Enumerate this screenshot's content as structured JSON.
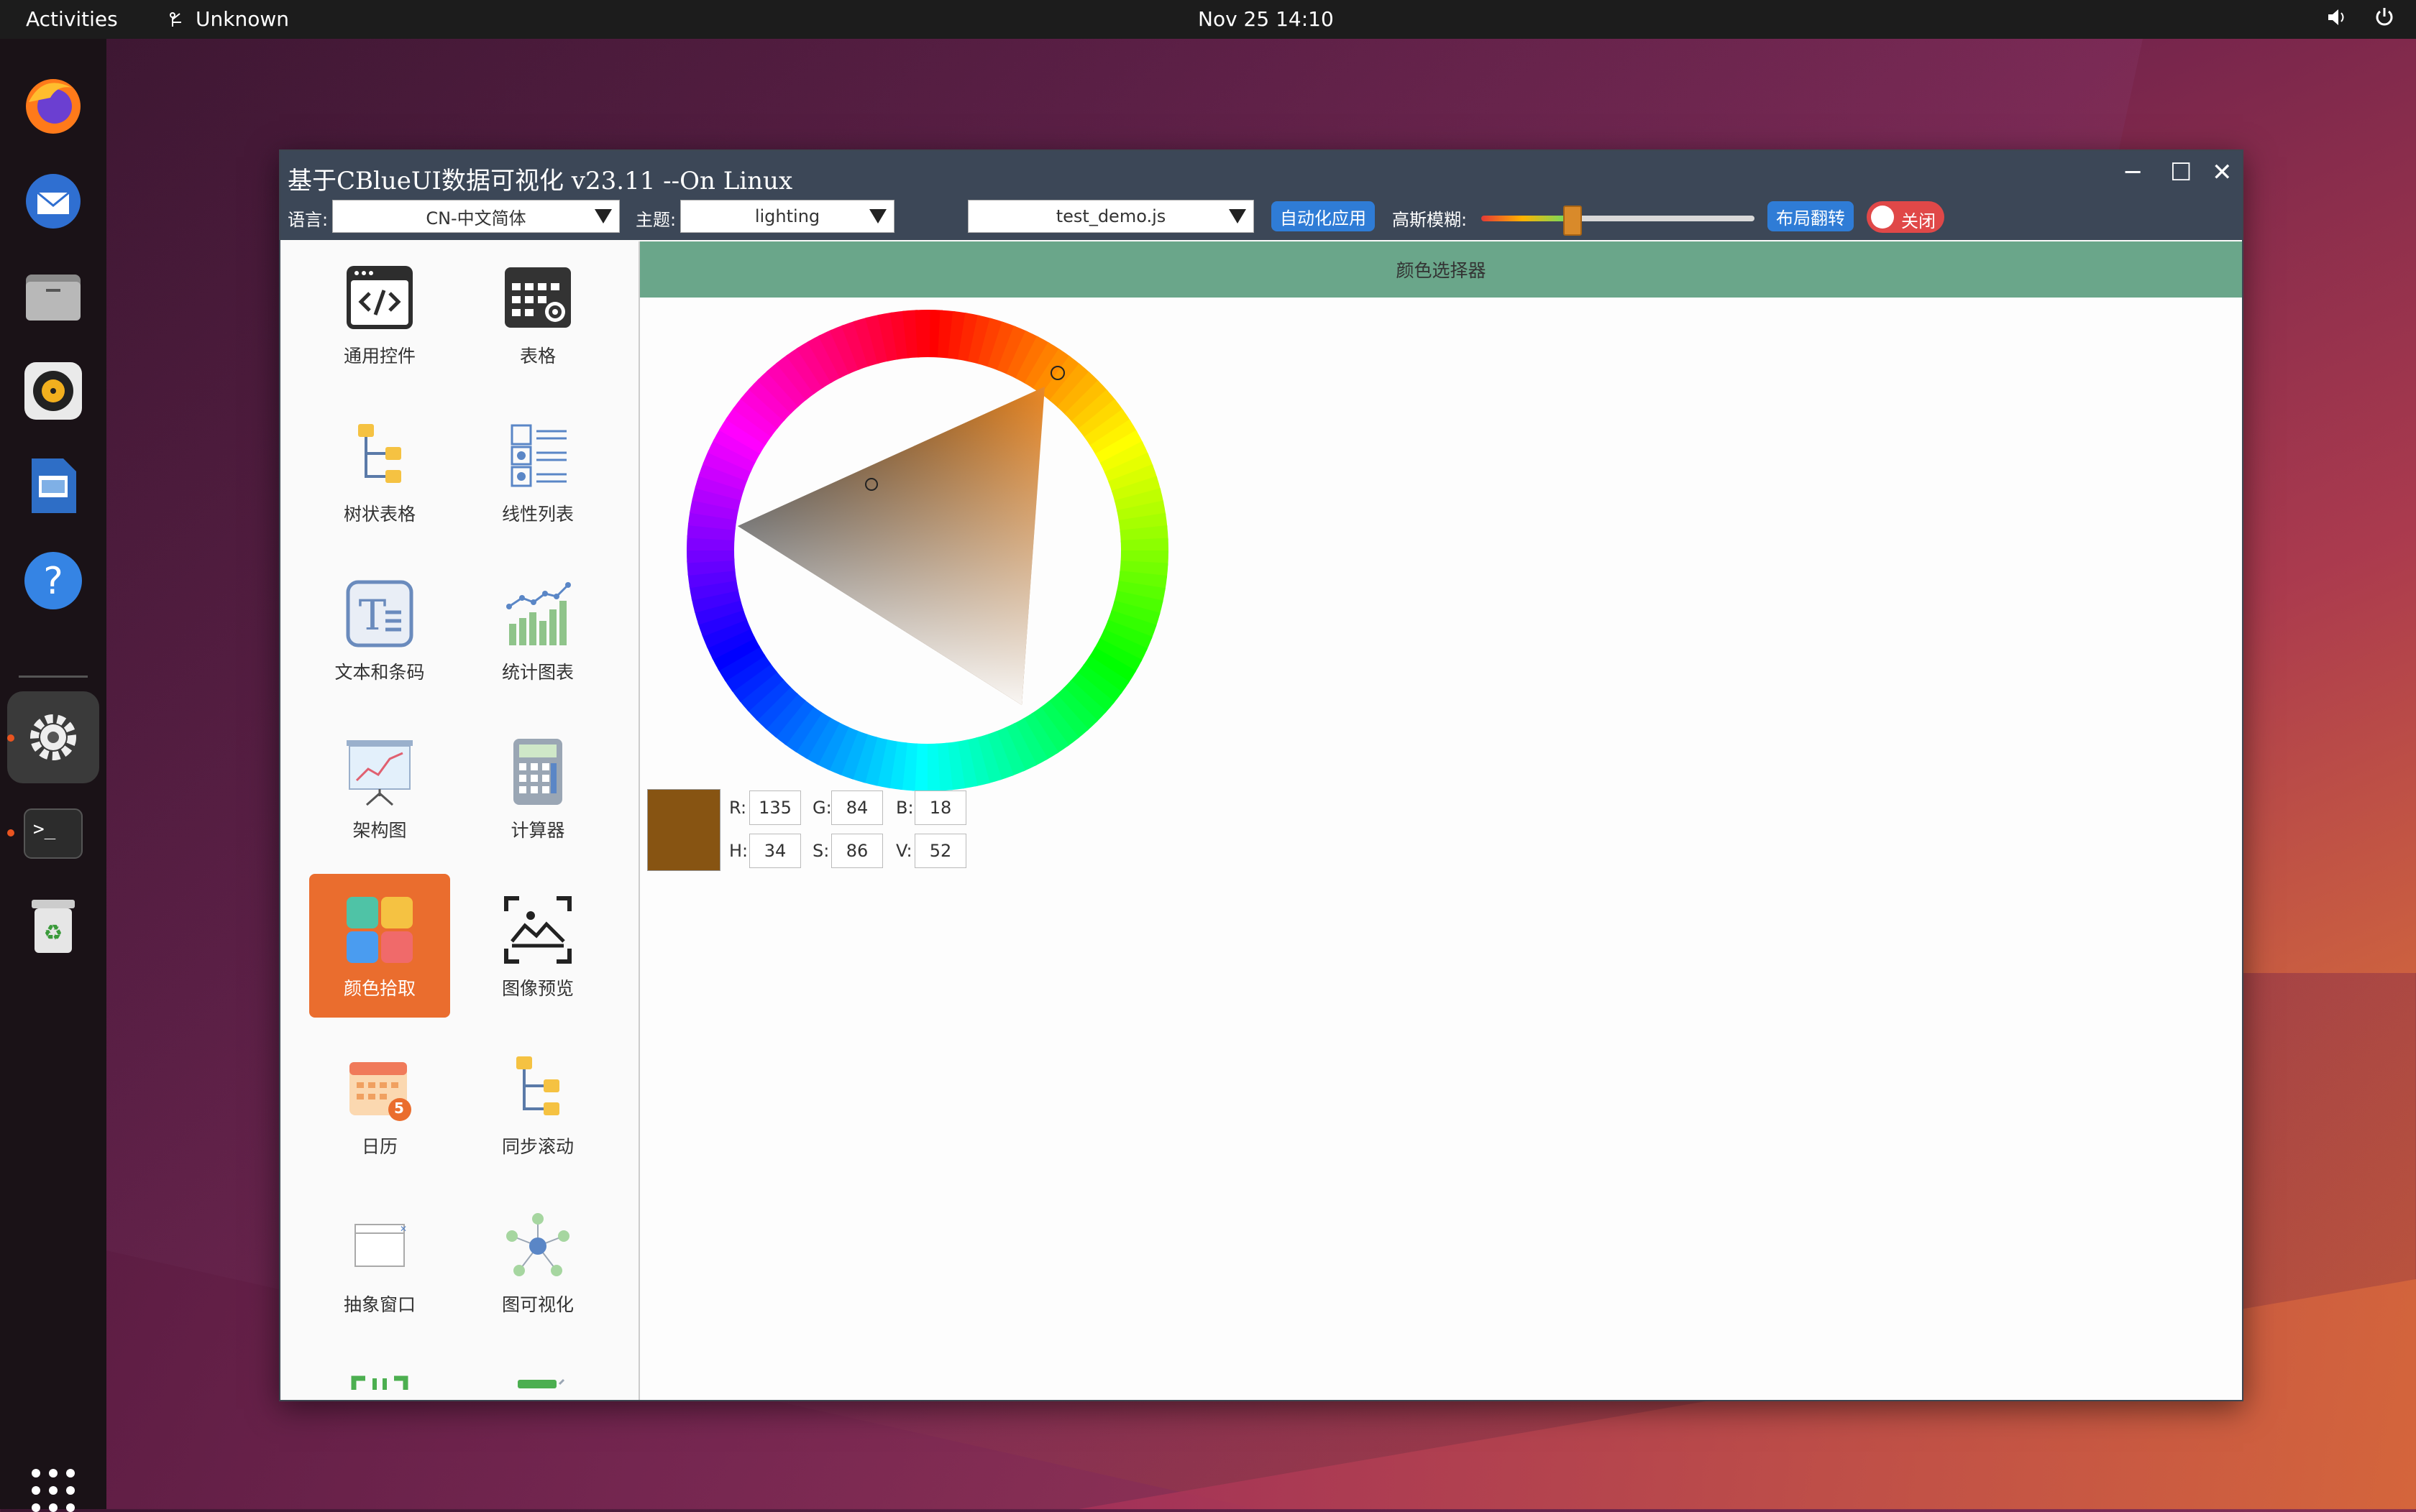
{
  "topbar": {
    "activities": "Activities",
    "app_name": "Unknown",
    "clock": "Nov 25  14:10"
  },
  "dock": {
    "items": [
      "firefox-icon",
      "thunderbird-icon",
      "files-icon",
      "rhythmbox-icon",
      "writer-icon",
      "help-icon",
      "settings-icon",
      "terminal-icon",
      "trash-icon"
    ],
    "active": "settings-icon"
  },
  "window": {
    "title": "基于CBlueUI数据可视化 v23.11 --On Linux",
    "toolbar": {
      "lang_label": "语言:",
      "lang_value": "CN-中文简体",
      "theme_label": "主题:",
      "theme_value": "lighting",
      "script_value": "test_demo.js",
      "auto_apply": "自动化应用",
      "blur_label": "高斯模糊:",
      "blur_level": 0.33,
      "layout_flip": "布局翻转",
      "toggle_text": "关闭"
    }
  },
  "sidebar": {
    "items": [
      {
        "label": "通用控件",
        "icon": "code-window-icon"
      },
      {
        "label": "表格",
        "icon": "table-gear-icon"
      },
      {
        "label": "树状表格",
        "icon": "tree-table-icon"
      },
      {
        "label": "线性列表",
        "icon": "linear-list-icon"
      },
      {
        "label": "文本和条码",
        "icon": "text-icon"
      },
      {
        "label": "统计图表",
        "icon": "bar-chart-icon"
      },
      {
        "label": "架构图",
        "icon": "presentation-chart-icon"
      },
      {
        "label": "计算器",
        "icon": "calculator-icon"
      },
      {
        "label": "颜色拾取",
        "icon": "color-picker-icon"
      },
      {
        "label": "图像预览",
        "icon": "image-preview-icon"
      },
      {
        "label": "日历",
        "icon": "calendar-icon"
      },
      {
        "label": "同步滚动",
        "icon": "sync-scroll-icon"
      },
      {
        "label": "抽象窗口",
        "icon": "abstract-window-icon"
      },
      {
        "label": "图可视化",
        "icon": "graph-icon"
      }
    ],
    "selected": "颜色拾取",
    "calendar_badge": "5"
  },
  "content": {
    "panel_title": "颜色选择器",
    "color": {
      "swatch_hex": "#875412",
      "r_label": "R:",
      "r": "135",
      "g_label": "G:",
      "g": "84",
      "b_label": "B:",
      "b": "18",
      "h_label": "H:",
      "h": "34",
      "s_label": "S:",
      "s": "86",
      "v_label": "V:",
      "v": "52"
    }
  }
}
